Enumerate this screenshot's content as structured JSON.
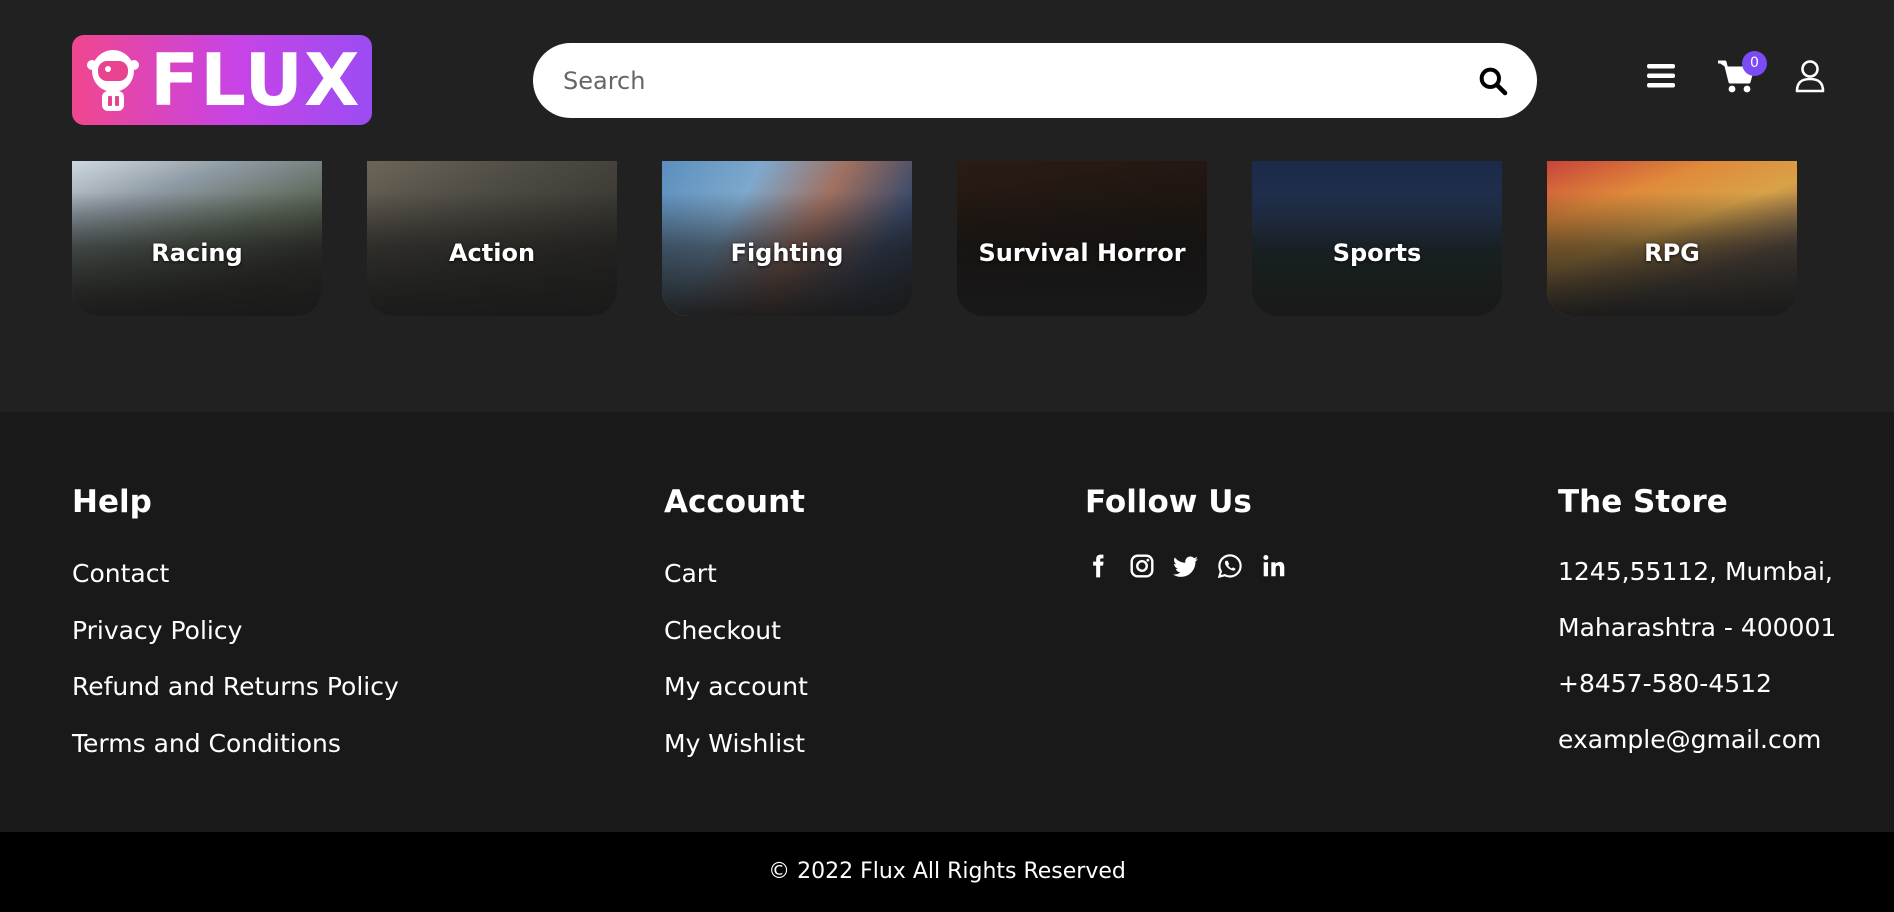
{
  "header": {
    "logo_text": "FLUX",
    "search_placeholder": "Search",
    "cart_count": "0",
    "icons": [
      "astronaut-icon",
      "search-icon",
      "menu-icon",
      "cart-icon",
      "user-icon"
    ]
  },
  "categories": [
    {
      "label": "Racing"
    },
    {
      "label": "Action"
    },
    {
      "label": "Fighting"
    },
    {
      "label": "Survival Horror"
    },
    {
      "label": "Sports"
    },
    {
      "label": "RPG"
    }
  ],
  "footer": {
    "help": {
      "title": "Help",
      "links": [
        "Contact",
        "Privacy Policy",
        "Refund and Returns Policy",
        "Terms and Conditions"
      ]
    },
    "account": {
      "title": "Account",
      "links": [
        "Cart",
        "Checkout",
        "My account",
        "My Wishlist"
      ]
    },
    "follow": {
      "title": "Follow Us",
      "icons": [
        "facebook-icon",
        "instagram-icon",
        "twitter-icon",
        "whatsapp-icon",
        "linkedin-icon"
      ]
    },
    "store": {
      "title": "The Store",
      "lines": [
        "1245,55112, Mumbai,",
        "Maharashtra - 400001",
        "+8457-580-4512",
        "example@gmail.com"
      ]
    }
  },
  "copyright": "© 2022 Flux All Rights Reserved",
  "colors": {
    "page_bg": "#212121",
    "footer_bg": "#191919",
    "bottom_bg": "#000000",
    "logo_gradient_start": "#f0468f",
    "logo_gradient_end": "#9b4cf2",
    "badge": "#7b4cf5"
  }
}
